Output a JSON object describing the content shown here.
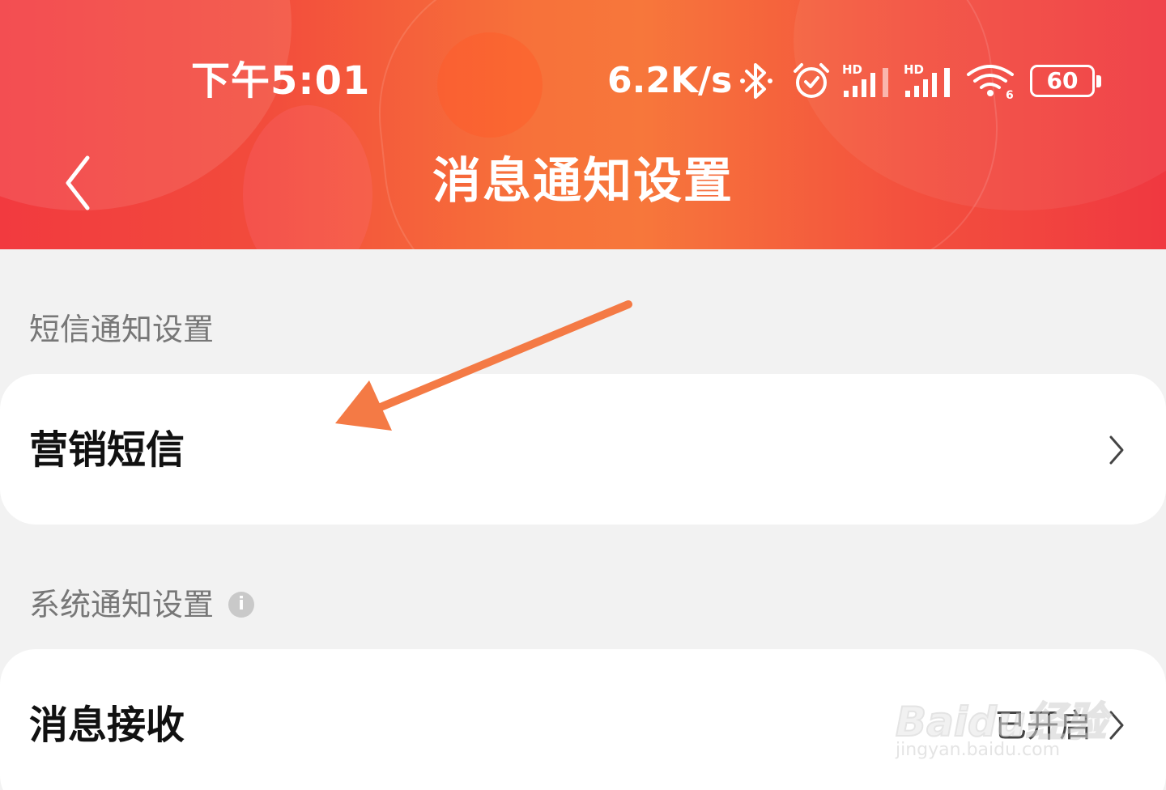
{
  "status_bar": {
    "time": "下午5:01",
    "net_speed": "6.2K/s",
    "battery": "60",
    "icons": [
      "bluetooth-icon",
      "alarm-icon",
      "signal-hd-icon",
      "signal-hd-icon",
      "wifi-icon",
      "battery-icon"
    ]
  },
  "nav": {
    "title": "消息通知设置",
    "back_icon": "chevron-left-icon"
  },
  "sections": [
    {
      "header": "短信通知设置",
      "rows": [
        {
          "label": "营销短信",
          "value": ""
        }
      ]
    },
    {
      "header": "系统通知设置",
      "info_icon": "i",
      "rows": [
        {
          "label": "消息接收",
          "value": "已开启"
        }
      ]
    }
  ],
  "watermark": {
    "logo": "Baidu经验",
    "url": "jingyan.baidu.com"
  },
  "colors": {
    "header_red": "#f23a3f",
    "header_orange": "#f7773b",
    "background": "#f2f2f2",
    "annotation_arrow": "#f47a45"
  }
}
